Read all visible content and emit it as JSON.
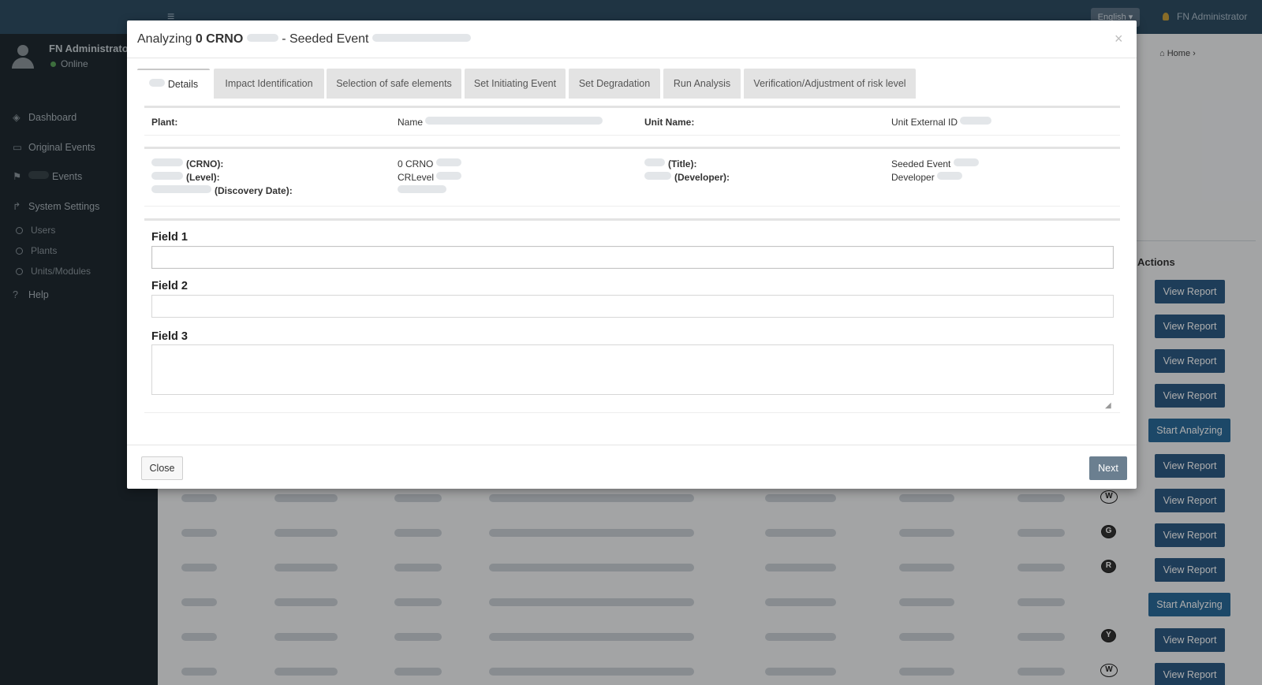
{
  "app": {
    "language_button": "English",
    "user_name": "FN Administrator",
    "user_status": "Online"
  },
  "sidebar": {
    "items": [
      {
        "label": "Dashboard",
        "icon": "dashboard-icon"
      },
      {
        "label": "Original Events",
        "icon": "inbox-icon"
      },
      {
        "label": "Events",
        "icon": "flag-icon"
      },
      {
        "label": "System Settings",
        "icon": "share-icon"
      }
    ],
    "sub_items": [
      "Users",
      "Plants",
      "Units/Modules"
    ],
    "help": "Help"
  },
  "breadcrumb": {
    "home": "Home"
  },
  "table": {
    "actions_header": "Actions",
    "action_buttons": [
      "View Report",
      "View Report",
      "View Report",
      "View Report",
      "Start Analyzing",
      "View Report",
      "View Report",
      "View Report",
      "View Report",
      "Start Analyzing",
      "View Report",
      "View Report"
    ],
    "status_badges": [
      "W",
      "G",
      "R",
      "Y",
      "W"
    ]
  },
  "modal": {
    "title_prefix": "Analyzing",
    "title_code": "0 CRNO",
    "title_suffix": "- Seeded Event",
    "close_symbol": "×",
    "tabs": [
      {
        "label": "Details",
        "active": true
      },
      {
        "label": "Impact Identification",
        "active": false
      },
      {
        "label": "Selection of safe elements",
        "active": false
      },
      {
        "label": "Set Initiating Event",
        "active": false
      },
      {
        "label": "Set Degradation",
        "active": false
      },
      {
        "label": "Run Analysis",
        "active": false
      },
      {
        "label": "Verification/Adjustment of risk level",
        "active": false
      }
    ],
    "info": {
      "plant_label": "Plant:",
      "name_label": "Name",
      "unit_name_label": "Unit Name:",
      "unit_external_id_label": "Unit External ID",
      "crno_label": "(CRNO):",
      "level_label": "(Level):",
      "discovery_date_label": "(Discovery Date):",
      "crno_value": "0 CRNO",
      "level_value": "CRLevel",
      "title_label": "(Title):",
      "developer_label": "(Developer):",
      "title_value": "Seeded Event",
      "developer_value": "Developer"
    },
    "fields": [
      {
        "label": "Field 1",
        "value": ""
      },
      {
        "label": "Field 2",
        "value": ""
      },
      {
        "label": "Field 3",
        "value": ""
      }
    ],
    "footer": {
      "close_label": "Close",
      "next_label": "Next"
    }
  },
  "colors": {
    "topbar": "#2f4d64",
    "sidebar": "#1f2a31",
    "action_button": "#2d5b84",
    "next_button": "#6b7f90"
  }
}
